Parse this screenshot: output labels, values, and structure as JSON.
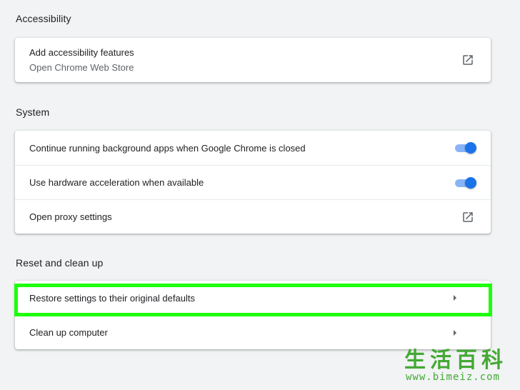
{
  "accessibility": {
    "title": "Accessibility",
    "item_primary": "Add accessibility features",
    "item_secondary": "Open Chrome Web Store"
  },
  "system": {
    "title": "System",
    "background_apps": {
      "label": "Continue running background apps when Google Chrome is closed",
      "enabled": true
    },
    "hardware_accel": {
      "label": "Use hardware acceleration when available",
      "enabled": true
    },
    "proxy": {
      "label": "Open proxy settings"
    }
  },
  "reset": {
    "title": "Reset and clean up",
    "restore_label": "Restore settings to their original defaults",
    "cleanup_label": "Clean up computer"
  },
  "colors": {
    "accent": "#1a73e8",
    "accent_light": "#8ab4f8",
    "highlight": "#1dff0b",
    "watermark": "#44a835"
  },
  "watermark": {
    "chars": [
      "生",
      "活",
      "百",
      "科"
    ],
    "url": "www.bimeiz.com"
  }
}
